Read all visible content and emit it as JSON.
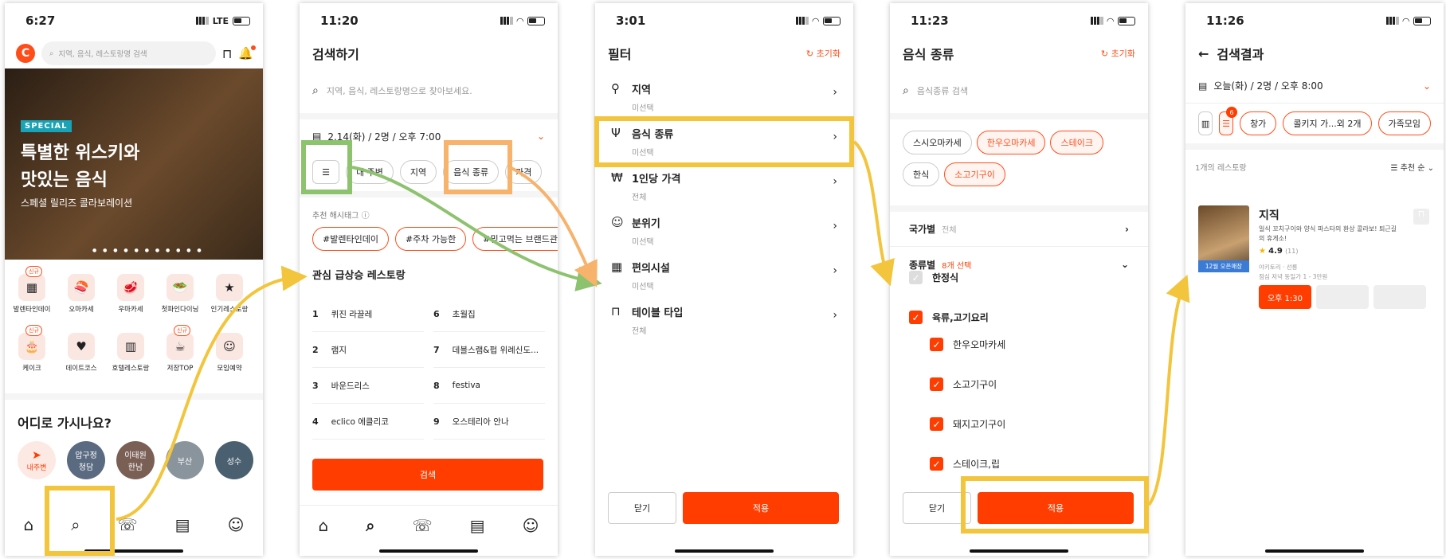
{
  "colors": {
    "accent": "#ff3d00",
    "highlight_yellow": "#f2c53d",
    "highlight_green": "#8dc26f",
    "highlight_orange": "#f7b26b"
  },
  "p1": {
    "time": "6:27",
    "net": "LTE",
    "logo": "C",
    "search_placeholder": "지역, 음식, 레스토랑명 검색",
    "banner": {
      "badge": "SPECIAL",
      "title1": "특별한 위스키와",
      "title2": "맛있는 음식",
      "sub": "스페셜 릴리즈 콜라보레이션"
    },
    "categories": [
      {
        "label": "발렌타인데이",
        "new": "신규",
        "icon": "▦"
      },
      {
        "label": "오마카세",
        "icon": "🍣"
      },
      {
        "label": "우마카세",
        "icon": "🥩"
      },
      {
        "label": "첫파인다이닝",
        "icon": "🥗"
      },
      {
        "label": "인기레스토랑",
        "icon": "★"
      },
      {
        "label": "케이크",
        "new": "신규",
        "icon": "🎂"
      },
      {
        "label": "데이트코스",
        "icon": "♥"
      },
      {
        "label": "호텔레스토랑",
        "icon": "▥"
      },
      {
        "label": "저장TOP",
        "new": "신규",
        "icon": "☕"
      },
      {
        "label": "모임예약",
        "icon": "☺"
      }
    ],
    "where_title": "어디로 가시나요?",
    "places": [
      {
        "label": "내주변"
      },
      {
        "label": "압구정\n청담"
      },
      {
        "label": "이태원\n한남"
      },
      {
        "label": "부산"
      },
      {
        "label": "성수"
      }
    ]
  },
  "p2": {
    "time": "11:20",
    "title": "검색하기",
    "search_placeholder": "지역, 음식, 레스토랑명으로 찾아보세요.",
    "date": "2.14(화) / 2명 / 오후 7:00",
    "chips": [
      "내 주변",
      "지역",
      "음식 종류",
      "가격"
    ],
    "hashtag_title": "추천 해시태그",
    "hashtags": [
      "#발렌타인데이",
      "#주차 가능한",
      "#믿고먹는 브랜드관"
    ],
    "rank_title": "관심 급상승 레스토랑",
    "ranks": [
      {
        "n": "1",
        "name": "퀴진 라끌레"
      },
      {
        "n": "2",
        "name": "램지"
      },
      {
        "n": "3",
        "name": "바운드리스"
      },
      {
        "n": "4",
        "name": "eclico 에클리코"
      },
      {
        "n": "6",
        "name": "초월집"
      },
      {
        "n": "7",
        "name": "데블스램&펍 위례신도..."
      },
      {
        "n": "8",
        "name": "festiva"
      },
      {
        "n": "9",
        "name": "오스테리아 안나"
      }
    ],
    "search_btn": "검색",
    "notif": "N"
  },
  "p3": {
    "time": "3:01",
    "title": "필터",
    "reset": "초기화",
    "rows": [
      {
        "icon": "⚲",
        "t": "지역",
        "s": "미선택"
      },
      {
        "icon": "Ψ",
        "t": "음식 종류",
        "s": "미선택"
      },
      {
        "icon": "₩",
        "t": "1인당 가격",
        "s": "전체"
      },
      {
        "icon": "☺",
        "t": "분위기",
        "s": "미선택"
      },
      {
        "icon": "▦",
        "t": "편의시설",
        "s": "미선택"
      },
      {
        "icon": "⊓",
        "t": "테이블 타입",
        "s": "전체"
      }
    ],
    "close": "닫기",
    "apply": "적용"
  },
  "p4": {
    "time": "11:23",
    "title": "음식 종류",
    "reset": "초기화",
    "search_placeholder": "음식종류 검색",
    "chips": [
      {
        "l": "스시오마카세",
        "on": false
      },
      {
        "l": "한우오마카세",
        "on": true
      },
      {
        "l": "스테이크",
        "on": true
      },
      {
        "l": "한식",
        "on": false
      },
      {
        "l": "소고기구이",
        "on": true
      }
    ],
    "country_label": "국가별",
    "country_val": "전체",
    "type_label": "종류별",
    "type_val": "8개 선택",
    "checks": [
      {
        "l": "한정식",
        "on": false
      },
      {
        "l": "육류,고기요리",
        "on": true
      },
      {
        "l": "한우오마카세",
        "on": true
      },
      {
        "l": "소고기구이",
        "on": true
      },
      {
        "l": "돼지고기구이",
        "on": true
      },
      {
        "l": "스테이크,립",
        "on": true
      }
    ],
    "close": "닫기",
    "apply": "적용"
  },
  "p5": {
    "time": "11:26",
    "title": "검색결과",
    "date": "오늘(화) / 2명 / 오후 8:00",
    "filter_badge": "6",
    "chips": [
      "창가",
      "콜키지 가...외 2개",
      "가족모임"
    ],
    "count": "1개의 레스토랑",
    "sort": "추천 순",
    "card": {
      "name": "지직",
      "desc1": "일식 꼬치구이와 양식 파스타의 환상 콜라보! 퇴근길",
      "desc2": "의 휴게소!",
      "rating": "4.9",
      "reviews": "(11)",
      "meta": "야키토리 · 선릉",
      "lunch": "점심 저녁 동일가 1 - 3만원",
      "ribbon": "12월 오픈매장",
      "time_slot": "오후 1:30"
    }
  }
}
